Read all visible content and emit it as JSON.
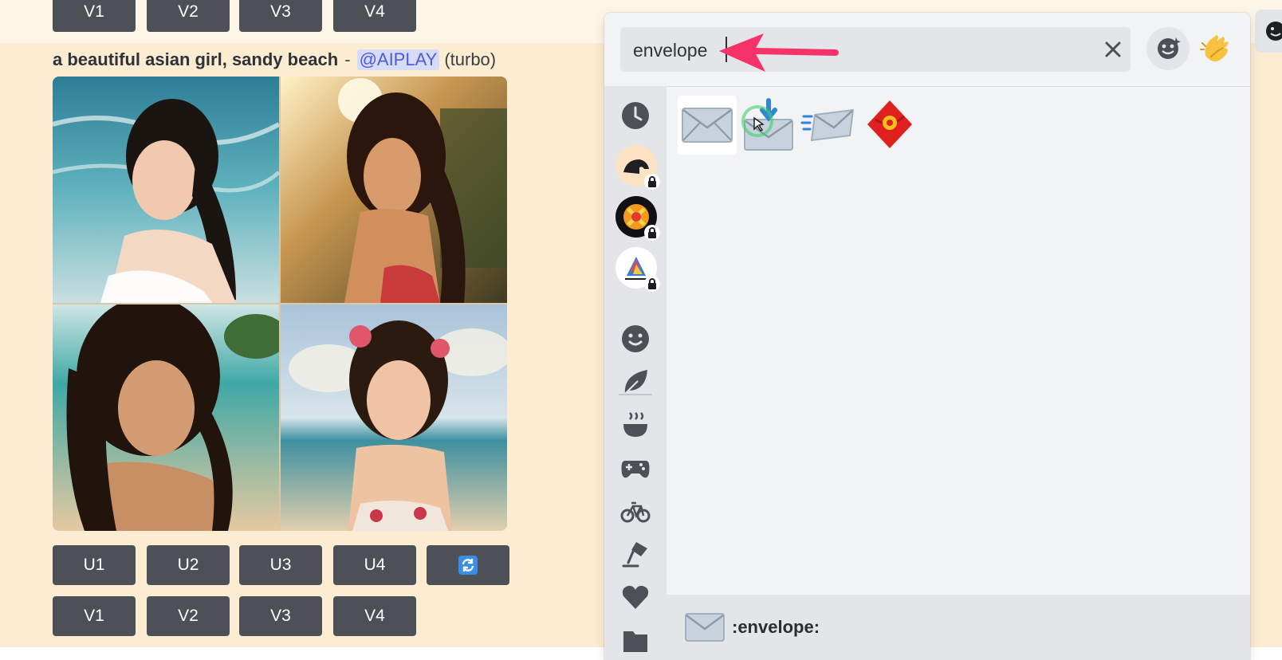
{
  "message": {
    "prompt": "a beautiful asian girl, sandy beach",
    "separator": "-",
    "mention": "@AIPLAY",
    "mode": "(turbo)"
  },
  "top_buttons": [
    "V1",
    "V2",
    "V3",
    "V4"
  ],
  "upscale_buttons": [
    "U1",
    "U2",
    "U3",
    "U4"
  ],
  "reroll_icon": "refresh-icon",
  "variation_buttons": [
    "V1",
    "V2",
    "V3",
    "V4"
  ],
  "picker": {
    "search_value": "envelope",
    "clear_icon": "close-icon",
    "header_buttons": [
      "nitro-emoji-icon",
      "clapping-hands-skin-tone-icon"
    ],
    "categories": [
      "recent-clock-icon",
      "server-emoji-1",
      "server-emoji-2",
      "server-emoji-3",
      "people-smiley-icon",
      "nature-leaf-icon",
      "food-bowl-icon",
      "activities-controller-icon",
      "travel-bicycle-icon",
      "objects-lamp-icon",
      "symbols-heart-icon",
      "flags-icon"
    ],
    "results": [
      "envelope",
      "envelope-with-arrow",
      "incoming-envelope",
      "red-envelope"
    ],
    "preview_name": ":envelope:"
  },
  "colors": {
    "button_bg": "#4e5058",
    "mention_text": "#4d5cd6",
    "annotation_arrow": "#f5336a",
    "cursor_highlight": "#3fcf6c"
  }
}
